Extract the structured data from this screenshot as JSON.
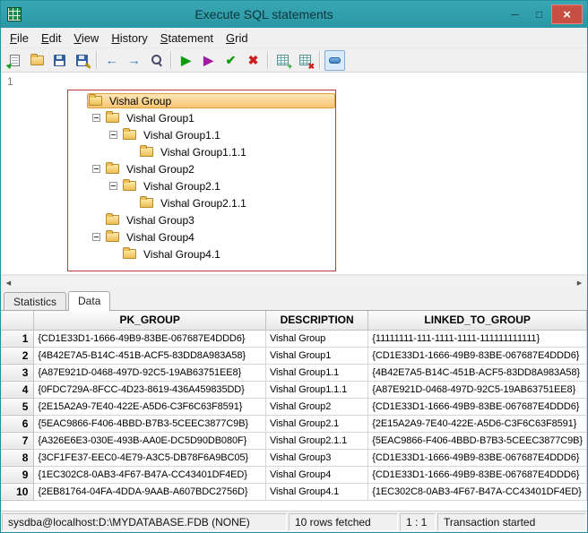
{
  "window": {
    "title": "Execute SQL statements",
    "controls": {
      "minimize": "─",
      "maximize": "□",
      "close": "×"
    }
  },
  "menu": {
    "items": [
      "File",
      "Edit",
      "View",
      "History",
      "Statement",
      "Grid"
    ]
  },
  "toolbar": {
    "groups": [
      [
        {
          "name": "load-script-button",
          "icon": "sheet-arrow"
        },
        {
          "name": "open-button",
          "icon": "folder-tb"
        },
        {
          "name": "save-button",
          "icon": "floppy"
        },
        {
          "name": "save-as-button",
          "icon": "floppy",
          "overlay": "✎",
          "overlay_color": "#b88a00"
        }
      ],
      [
        {
          "name": "back-button",
          "glyph": "←",
          "color": "#2f6fae"
        },
        {
          "name": "forward-button",
          "glyph": "→",
          "color": "#2f6fae"
        },
        {
          "name": "search-button",
          "icon": "magnifier"
        }
      ],
      [
        {
          "name": "execute-button",
          "glyph": "▶",
          "color": "#0f9d0f"
        },
        {
          "name": "execute-script-button",
          "glyph": "▶",
          "color": "#a21aa2"
        },
        {
          "name": "commit-button",
          "glyph": "✔",
          "color": "#0f9d0f"
        },
        {
          "name": "rollback-button",
          "glyph": "✖",
          "color": "#cc2020"
        }
      ],
      [
        {
          "name": "show-grid-button",
          "icon": "grid",
          "overlay": "+",
          "overlay_color": "#089a08"
        },
        {
          "name": "close-grid-button",
          "icon": "grid",
          "overlay": "✖",
          "overlay_color": "#cc2020"
        }
      ],
      [
        {
          "name": "toggle-layout-button",
          "icon": "toggle-bar",
          "pressed": true
        }
      ]
    ]
  },
  "editor": {
    "line_number": "1"
  },
  "tree": {
    "items": [
      {
        "label": "Vishal Group",
        "depth": 0,
        "expandable": false,
        "selected": true
      },
      {
        "label": "Vishal Group1",
        "depth": 1,
        "expandable": true,
        "selected": false
      },
      {
        "label": "Vishal Group1.1",
        "depth": 2,
        "expandable": true,
        "selected": false
      },
      {
        "label": "Vishal Group1.1.1",
        "depth": 3,
        "expandable": false,
        "selected": false
      },
      {
        "label": "Vishal Group2",
        "depth": 1,
        "expandable": true,
        "selected": false
      },
      {
        "label": "Vishal Group2.1",
        "depth": 2,
        "expandable": true,
        "selected": false
      },
      {
        "label": "Vishal Group2.1.1",
        "depth": 3,
        "expandable": false,
        "selected": false
      },
      {
        "label": "Vishal Group3",
        "depth": 1,
        "expandable": false,
        "selected": false
      },
      {
        "label": "Vishal Group4",
        "depth": 1,
        "expandable": true,
        "selected": false
      },
      {
        "label": "Vishal Group4.1",
        "depth": 2,
        "expandable": false,
        "selected": false
      }
    ]
  },
  "scrollbar": {
    "left": "◀",
    "right": "▶"
  },
  "tabs": {
    "items": [
      "Statistics",
      "Data"
    ],
    "active": "Data"
  },
  "grid": {
    "columns": [
      "PK_GROUP",
      "DESCRIPTION",
      "LINKED_TO_GROUP"
    ],
    "rows": [
      {
        "num": "1",
        "pk_group": "{CD1E33D1-1666-49B9-83BE-067687E4DDD6}",
        "description": "Vishal Group",
        "linked_to_group": "{11111111-111-1111-1111-111111111111}"
      },
      {
        "num": "2",
        "pk_group": "{4B42E7A5-B14C-451B-ACF5-83DD8A983A58}",
        "description": "Vishal Group1",
        "linked_to_group": "{CD1E33D1-1666-49B9-83BE-067687E4DDD6}"
      },
      {
        "num": "3",
        "pk_group": "{A87E921D-0468-497D-92C5-19AB63751EE8}",
        "description": "Vishal Group1.1",
        "linked_to_group": "{4B42E7A5-B14C-451B-ACF5-83DD8A983A58}"
      },
      {
        "num": "4",
        "pk_group": "{0FDC729A-8FCC-4D23-8619-436A459835DD}",
        "description": "Vishal Group1.1.1",
        "linked_to_group": "{A87E921D-0468-497D-92C5-19AB63751EE8}"
      },
      {
        "num": "5",
        "pk_group": "{2E15A2A9-7E40-422E-A5D6-C3F6C63F8591}",
        "description": "Vishal Group2",
        "linked_to_group": "{CD1E33D1-1666-49B9-83BE-067687E4DDD6}"
      },
      {
        "num": "6",
        "pk_group": "{5EAC9866-F406-4BBD-B7B3-5CEEC3877C9B}",
        "description": "Vishal Group2.1",
        "linked_to_group": "{2E15A2A9-7E40-422E-A5D6-C3F6C63F8591}"
      },
      {
        "num": "7",
        "pk_group": "{A326E6E3-030E-493B-AA0E-DC5D90DB080F}",
        "description": "Vishal Group2.1.1",
        "linked_to_group": "{5EAC9866-F406-4BBD-B7B3-5CEEC3877C9B}"
      },
      {
        "num": "8",
        "pk_group": "{3CF1FE37-EEC0-4E79-A3C5-DB78F6A9BC05}",
        "description": "Vishal Group3",
        "linked_to_group": "{CD1E33D1-1666-49B9-83BE-067687E4DDD6}"
      },
      {
        "num": "9",
        "pk_group": "{1EC302C8-0AB3-4F67-B47A-CC43401DF4ED}",
        "description": "Vishal Group4",
        "linked_to_group": "{CD1E33D1-1666-49B9-83BE-067687E4DDD6}"
      },
      {
        "num": "10",
        "pk_group": "{2EB81764-04FA-4DDA-9AAB-A607BDC2756D}",
        "description": "Vishal Group4.1",
        "linked_to_group": "{1EC302C8-0AB3-4F67-B47A-CC43401DF4ED}"
      }
    ]
  },
  "status": {
    "panels": [
      "sysdba@localhost:D:\\MYDATABASE.FDB (NONE)",
      "10 rows fetched",
      "1 : 1",
      "Transaction started"
    ]
  }
}
